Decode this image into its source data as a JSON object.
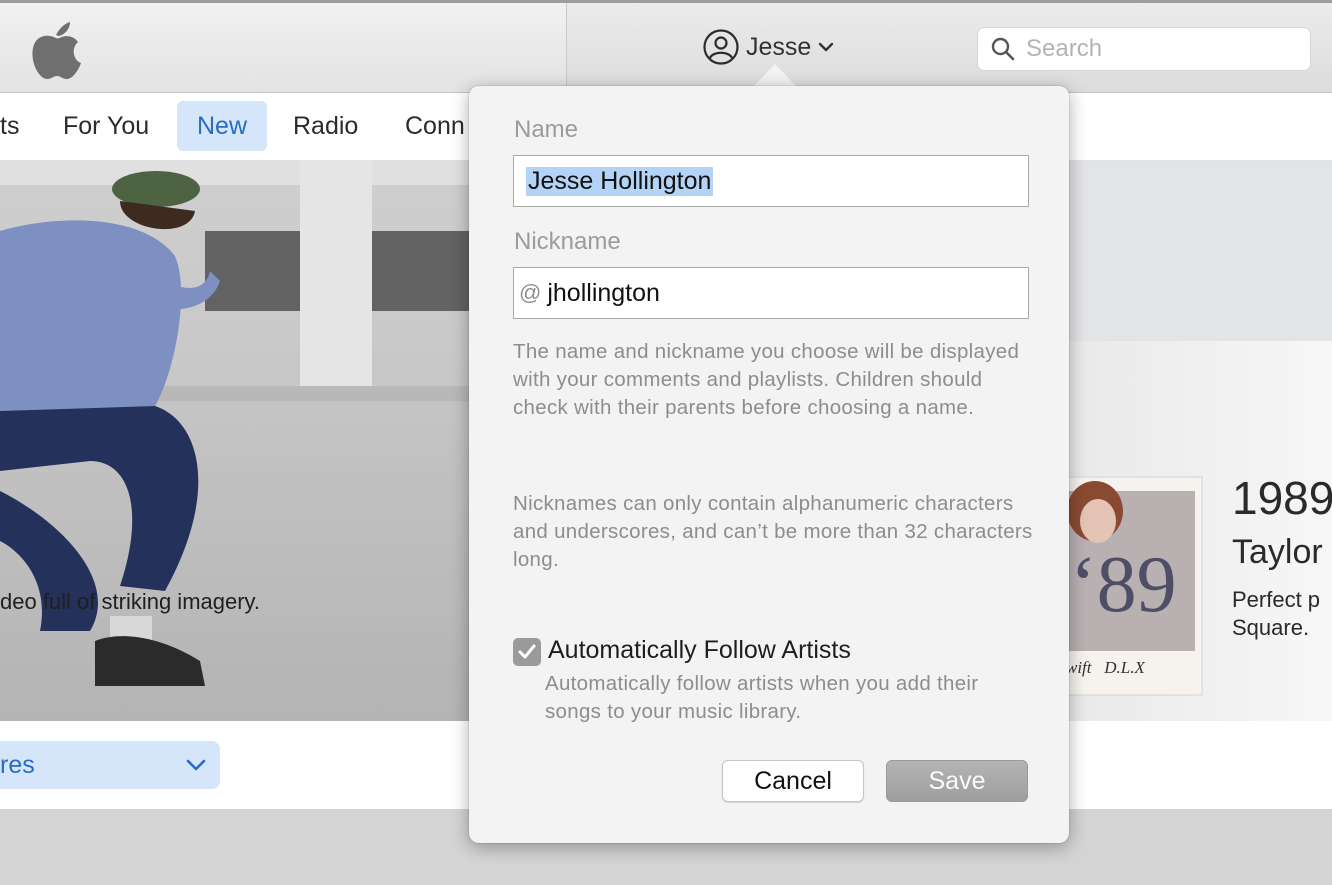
{
  "colors": {
    "accent": "#2a6cc1",
    "accent_bg": "#d6e6fa",
    "selection": "#b3d3f7"
  },
  "toolbar": {
    "account_name": "Jesse",
    "account_icon": "person-circle-icon",
    "search_placeholder": "Search"
  },
  "nav": {
    "items": [
      {
        "label": "ts"
      },
      {
        "label": "For You"
      },
      {
        "label": "New",
        "active": true
      },
      {
        "label": "Radio"
      },
      {
        "label": "Conn"
      }
    ]
  },
  "content": {
    "hero_caption": "deo full of striking imagery.",
    "album_title": "1989",
    "album_artist": "Taylor",
    "album_desc": "Perfect p Square.",
    "album_cover_text": "wift   D.L.X",
    "genres_label": "res"
  },
  "popover": {
    "name_label": "Name",
    "name_value": "Jesse Hollington",
    "nickname_label": "Nickname",
    "nickname_prefix": "@",
    "nickname_value": "jhollington",
    "help_1": "The name and nickname you choose will be displayed with your comments and playlists. Children should check with their parents before choosing a name.",
    "help_2": "Nicknames can only contain alphanumeric characters and underscores, and can’t be more than 32 characters long.",
    "follow_label": "Automatically Follow Artists",
    "follow_checked": true,
    "follow_desc": "Automatically follow artists when you add their songs to your music library.",
    "cancel_label": "Cancel",
    "save_label": "Save"
  }
}
